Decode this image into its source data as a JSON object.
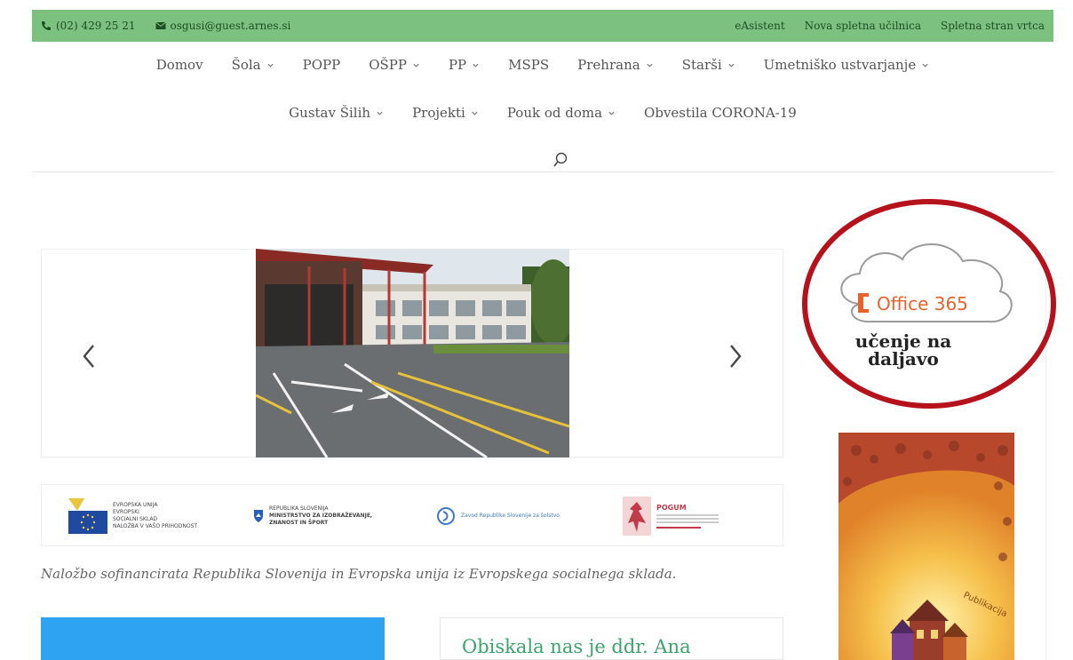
{
  "topbar": {
    "phone": "(02) 429 25 21",
    "email": "osgusi@guest.arnes.si",
    "links": [
      "eAsistent",
      "Nova spletna učilnica",
      "Spletna stran vrtca"
    ]
  },
  "nav": {
    "row1": [
      {
        "label": "Domov",
        "dropdown": false
      },
      {
        "label": "Šola",
        "dropdown": true
      },
      {
        "label": "POPP",
        "dropdown": false
      },
      {
        "label": "OŠPP",
        "dropdown": true
      },
      {
        "label": "PP",
        "dropdown": true
      },
      {
        "label": "MSPS",
        "dropdown": false
      },
      {
        "label": "Prehrana",
        "dropdown": true
      },
      {
        "label": "Starši",
        "dropdown": true
      },
      {
        "label": "Umetniško ustvarjanje",
        "dropdown": true
      }
    ],
    "row2": [
      {
        "label": "Gustav Šilih",
        "dropdown": true
      },
      {
        "label": "Projekti",
        "dropdown": true
      },
      {
        "label": "Pouk od doma",
        "dropdown": true
      },
      {
        "label": "Obvestila CORONA-19",
        "dropdown": false
      }
    ]
  },
  "logos": {
    "eu_line1": "EVROPSKA UNIJA",
    "eu_line2": "EVROPSKI",
    "eu_line3": "SOCIALNI SKLAD",
    "eu_line4": "NALOŽBA V VAŠO PRIHODNOST",
    "ministry_line1": "REPUBLIKA SLOVENIJA",
    "ministry_line2": "MINISTRSTVO ZA IZOBRAŽEVANJE,",
    "ministry_line3": "ZNANOST IN ŠPORT",
    "zavod": "Zavod Republike Slovenije za šolstvo",
    "pogum": "POGUM"
  },
  "caption": "Naložbo sofinancirata Republika Slovenija in Evropska unija iz Evropskega socialnega sklada.",
  "post": {
    "title": "Obiskala nas je ddr. Ana"
  },
  "sidebar": {
    "office_label": "Office 365",
    "office_line1": "učenje na",
    "office_line2": "daljavo",
    "poster_text": "Publikacija"
  },
  "colors": {
    "topbar": "#7dc181",
    "accent_blue": "#2ea3f2",
    "annotation_red": "#b5121b",
    "office_orange": "#e8632b"
  }
}
